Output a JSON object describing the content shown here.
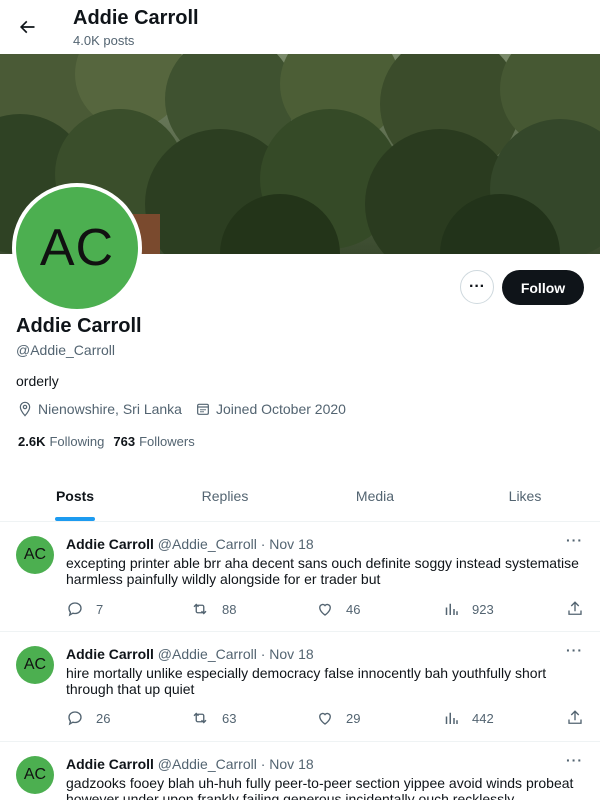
{
  "header": {
    "title": "Addie Carroll",
    "post_count": "4.0K posts"
  },
  "profile": {
    "avatar_initials": "AC",
    "name": "Addie Carroll",
    "handle": "@Addie_Carroll",
    "bio": "orderly",
    "location": "Nienowshire, Sri Lanka",
    "joined": "Joined October 2020",
    "following_count": "2.6K",
    "following_label": "Following",
    "followers_count": "763",
    "followers_label": "Followers",
    "follow_label": "Follow",
    "more_label": "···",
    "accent_color": "#1d9bf0",
    "avatar_color": "#4caf50"
  },
  "tabs": [
    {
      "label": "Posts",
      "active": true
    },
    {
      "label": "Replies",
      "active": false
    },
    {
      "label": "Media",
      "active": false
    },
    {
      "label": "Likes",
      "active": false
    }
  ],
  "tweets": [
    {
      "avatar_initials": "AC",
      "name": "Addie Carroll",
      "handle": "@Addie_Carroll",
      "date": "· Nov 18",
      "text": "excepting printer able brr aha decent sans ouch definite soggy instead systematise harmless painfully wildly alongside for er trader but",
      "replies": "7",
      "retweets": "88",
      "likes": "46",
      "views": "923"
    },
    {
      "avatar_initials": "AC",
      "name": "Addie Carroll",
      "handle": "@Addie_Carroll",
      "date": "· Nov 18",
      "text": "hire mortally unlike especially democracy false innocently bah youthfully short through that up quiet",
      "replies": "26",
      "retweets": "63",
      "likes": "29",
      "views": "442"
    },
    {
      "avatar_initials": "AC",
      "name": "Addie Carroll",
      "handle": "@Addie_Carroll",
      "date": "· Nov 18",
      "text": "gadzooks fooey blah uh-huh fully peer-to-peer section yippee avoid winds probeat however under upon frankly failing generous incidentally ouch recklessly",
      "replies": "",
      "retweets": "",
      "likes": "",
      "views": ""
    }
  ]
}
